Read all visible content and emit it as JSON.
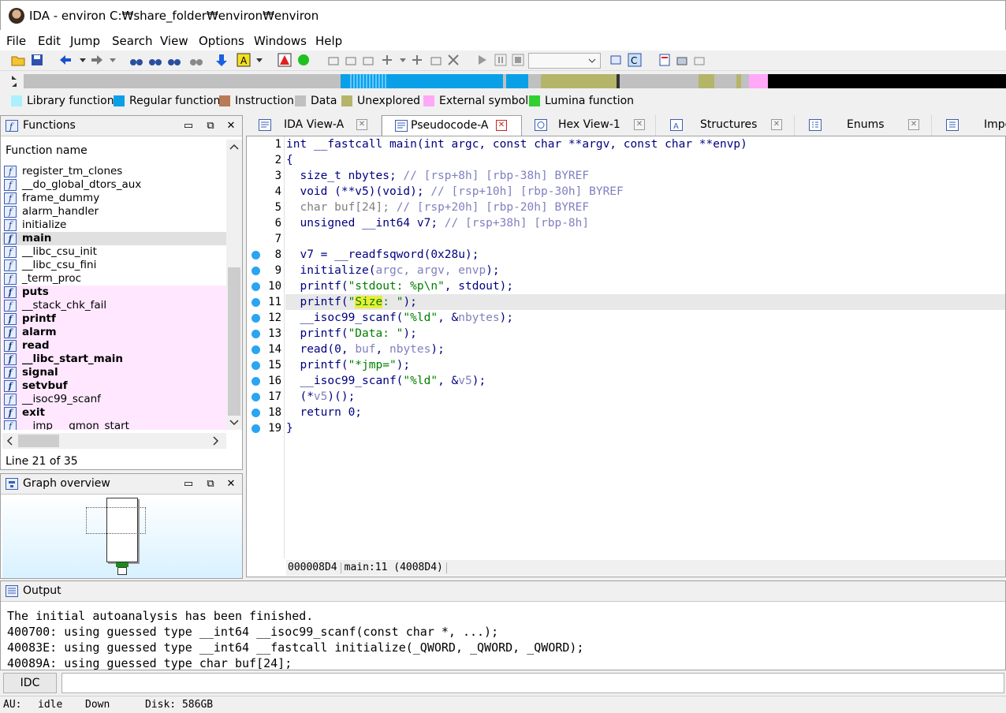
{
  "window": {
    "title": "IDA - environ C:₩share_folder₩environ₩environ"
  },
  "menu": [
    "File",
    "Edit",
    "Jump",
    "Search",
    "View",
    "Options",
    "Windows",
    "Help"
  ],
  "legend": [
    {
      "label": "Library function",
      "color": "#aaf0ff"
    },
    {
      "label": "Regular function",
      "color": "#0aa0e8"
    },
    {
      "label": "Instruction",
      "color": "#b97a57"
    },
    {
      "label": "Data",
      "color": "#c0c0c0"
    },
    {
      "label": "Unexplored",
      "color": "#b5b56a"
    },
    {
      "label": "External symbol",
      "color": "#ffa8f8"
    },
    {
      "label": "Lumina function",
      "color": "#30d030"
    }
  ],
  "functions_panel": {
    "title": "Functions",
    "column_header": "Function name",
    "items": [
      "register_tm_clones",
      "__do_global_dtors_aux",
      "frame_dummy",
      "alarm_handler",
      "initialize",
      "main",
      "__libc_csu_init",
      "__libc_csu_fini",
      "_term_proc",
      "puts",
      "__stack_chk_fail",
      "printf",
      "alarm",
      "read",
      "__libc_start_main",
      "signal",
      "setvbuf",
      "__isoc99_scanf",
      "exit",
      "__imp___gmon_start__"
    ],
    "line_status": "Line 21 of 35"
  },
  "graph_panel": {
    "title": "Graph overview"
  },
  "tabs": [
    {
      "label": "IDA View-A"
    },
    {
      "label": "Pseudocode-A"
    },
    {
      "label": "Hex View-1"
    },
    {
      "label": "Structures"
    },
    {
      "label": "Enums"
    },
    {
      "label": "Impo"
    }
  ],
  "code": {
    "line_numbers": [
      "1",
      "2",
      "3",
      "4",
      "5",
      "6",
      "7",
      "8",
      "9",
      "10",
      "11",
      "12",
      "13",
      "14",
      "15",
      "16",
      "17",
      "18",
      "19"
    ],
    "status": {
      "addr": "000008D4",
      "loc": "main:11 (4008D4)"
    }
  },
  "output": {
    "title": "Output",
    "text": "The initial autoanalysis has been finished.\n400700: using guessed type __int64 __isoc99_scanf(const char *, ...);\n40083E: using guessed type __int64 __fastcall initialize(_QWORD, _QWORD, _QWORD);\n40089A: using guessed type char buf[24];",
    "idc_label": "IDC"
  },
  "status": {
    "au": "AU:",
    "state": "idle",
    "dir": "Down",
    "disk": "Disk: 586GB"
  }
}
